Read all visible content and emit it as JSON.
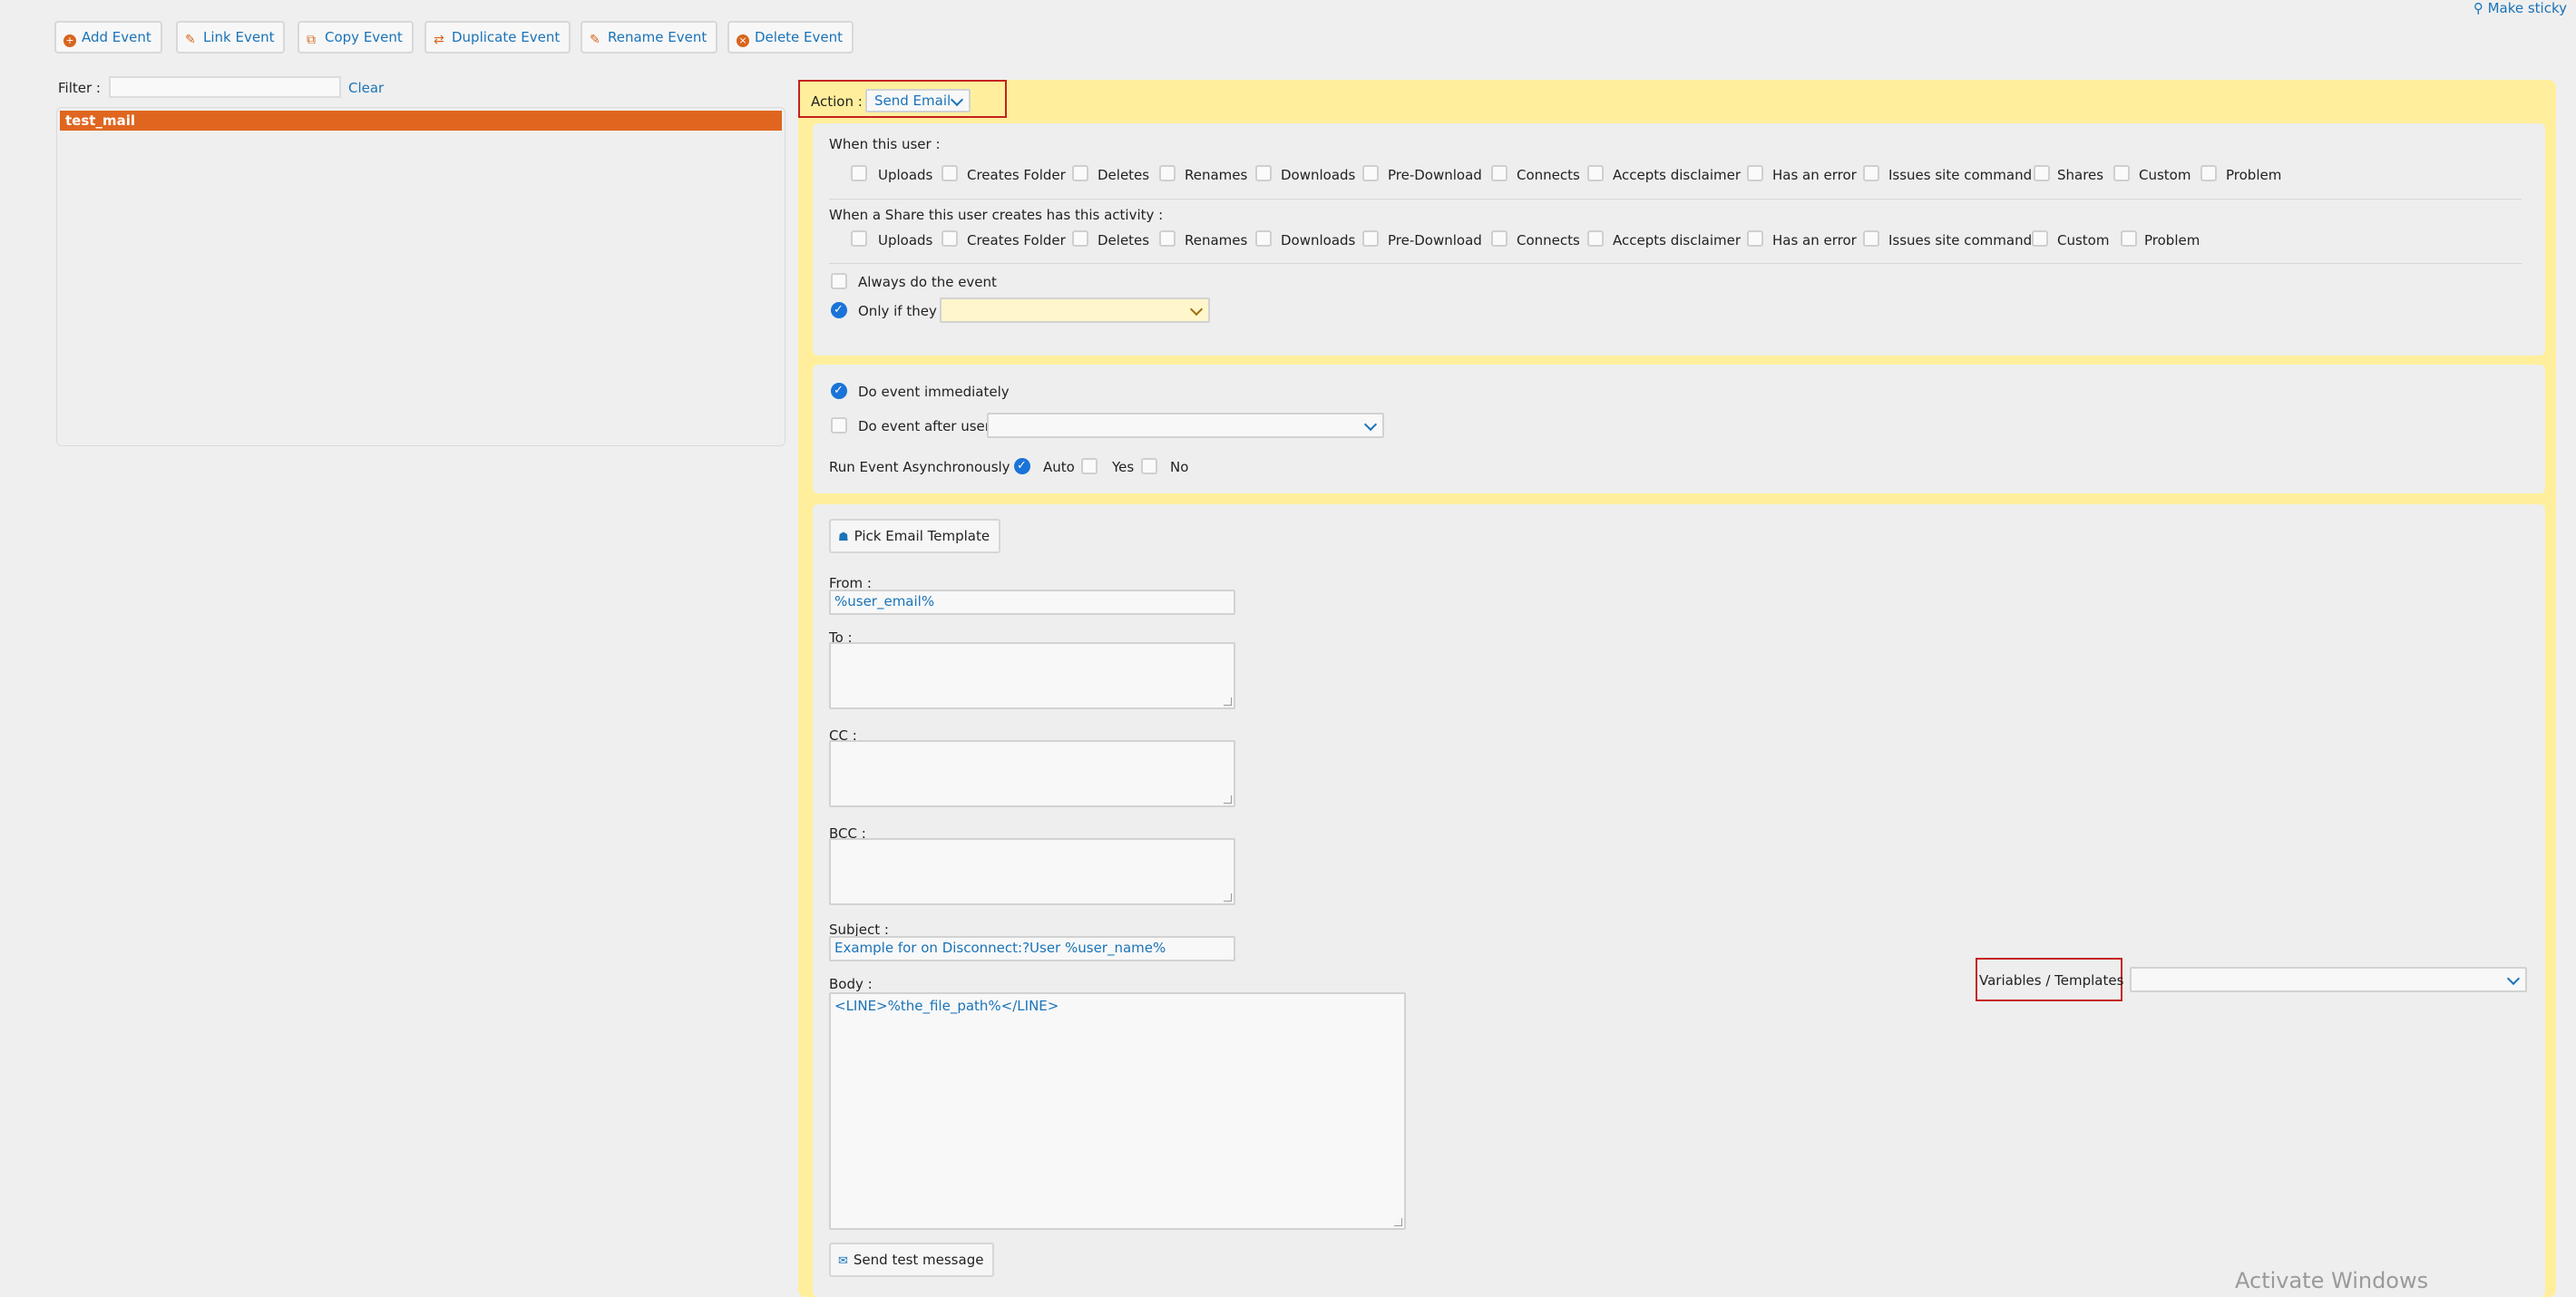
{
  "top_right": {
    "make_sticky": "Make sticky"
  },
  "toolbar": {
    "add_event": "Add Event",
    "link_event": "Link Event",
    "copy_event": "Copy Event",
    "duplicate_event": "Duplicate Event",
    "rename_event": "Rename Event",
    "delete_event": "Delete Event"
  },
  "filter": {
    "label": "Filter :",
    "value": "",
    "clear": "Clear"
  },
  "event_list": [
    {
      "name": "test_mail",
      "selected": true
    }
  ],
  "action": {
    "label": "Action :",
    "value": "Send Email"
  },
  "user_triggers": {
    "label": "When this user :",
    "items": [
      "Uploads",
      "Creates Folder",
      "Deletes",
      "Renames",
      "Downloads",
      "Pre-Download",
      "Connects",
      "Accepts disclaimer",
      "Has an error",
      "Issues site command",
      "Shares",
      "Custom",
      "Problem"
    ]
  },
  "share_triggers": {
    "label": "When a Share this user creates has this activity :",
    "items": [
      "Uploads",
      "Creates Folder",
      "Deletes",
      "Renames",
      "Downloads",
      "Pre-Download",
      "Connects",
      "Accepts disclaimer",
      "Has an error",
      "Issues site command",
      "Custom",
      "Problem"
    ]
  },
  "conditions": {
    "always": "Always do the event",
    "only_if": "Only if they",
    "only_if_checked": true
  },
  "timing": {
    "immediately": "Do event immediately",
    "immediately_checked": true,
    "after_user": "Do event after user",
    "async_label": "Run Event Asynchronously :",
    "async_options": [
      "Auto",
      "Yes",
      "No"
    ],
    "async_selected": "Auto"
  },
  "email": {
    "pick_template": "Pick Email Template",
    "from_label": "From :",
    "from_value": "%user_email%",
    "to_label": "To :",
    "cc_label": "CC :",
    "bcc_label": "BCC :",
    "subject_label": "Subject :",
    "subject_value": "Example for on Disconnect:?User %user_name%",
    "body_label": "Body :",
    "body_value": "<LINE>%the_file_path%</LINE>",
    "variables_label": "Variables / Templates",
    "send_test": "Send test message"
  },
  "overlay": {
    "activate_windows": "Activate Windows"
  },
  "colors": {
    "accent": "#1a73b8",
    "selected_row": "#e0661f",
    "panel": "#ffef9c",
    "highlight_box": "#c62020"
  }
}
